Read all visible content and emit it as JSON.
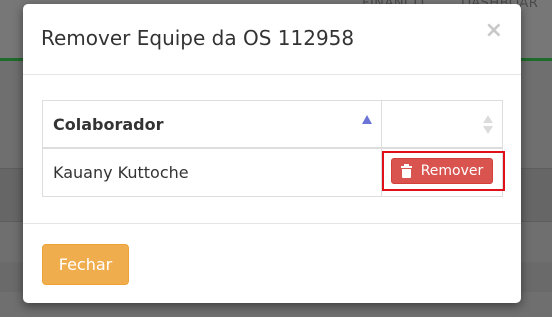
{
  "background": {
    "nav_items": [
      "FINANCO",
      "DASHBOAR"
    ]
  },
  "modal": {
    "title": "Remover Equipe da OS 112958",
    "close_glyph": "×",
    "table": {
      "columns": [
        "Colaborador",
        ""
      ],
      "rows": [
        {
          "name": "Kauany Kuttoche",
          "action_label": "Remover"
        }
      ]
    },
    "footer": {
      "close_label": "Fechar"
    }
  },
  "colors": {
    "danger": "#d9534f",
    "warning": "#f0ad4e",
    "highlight": "#e0101a",
    "sort_active": "#6b75d6"
  },
  "icons": {
    "remove": "trash-icon",
    "close": "close-icon"
  }
}
